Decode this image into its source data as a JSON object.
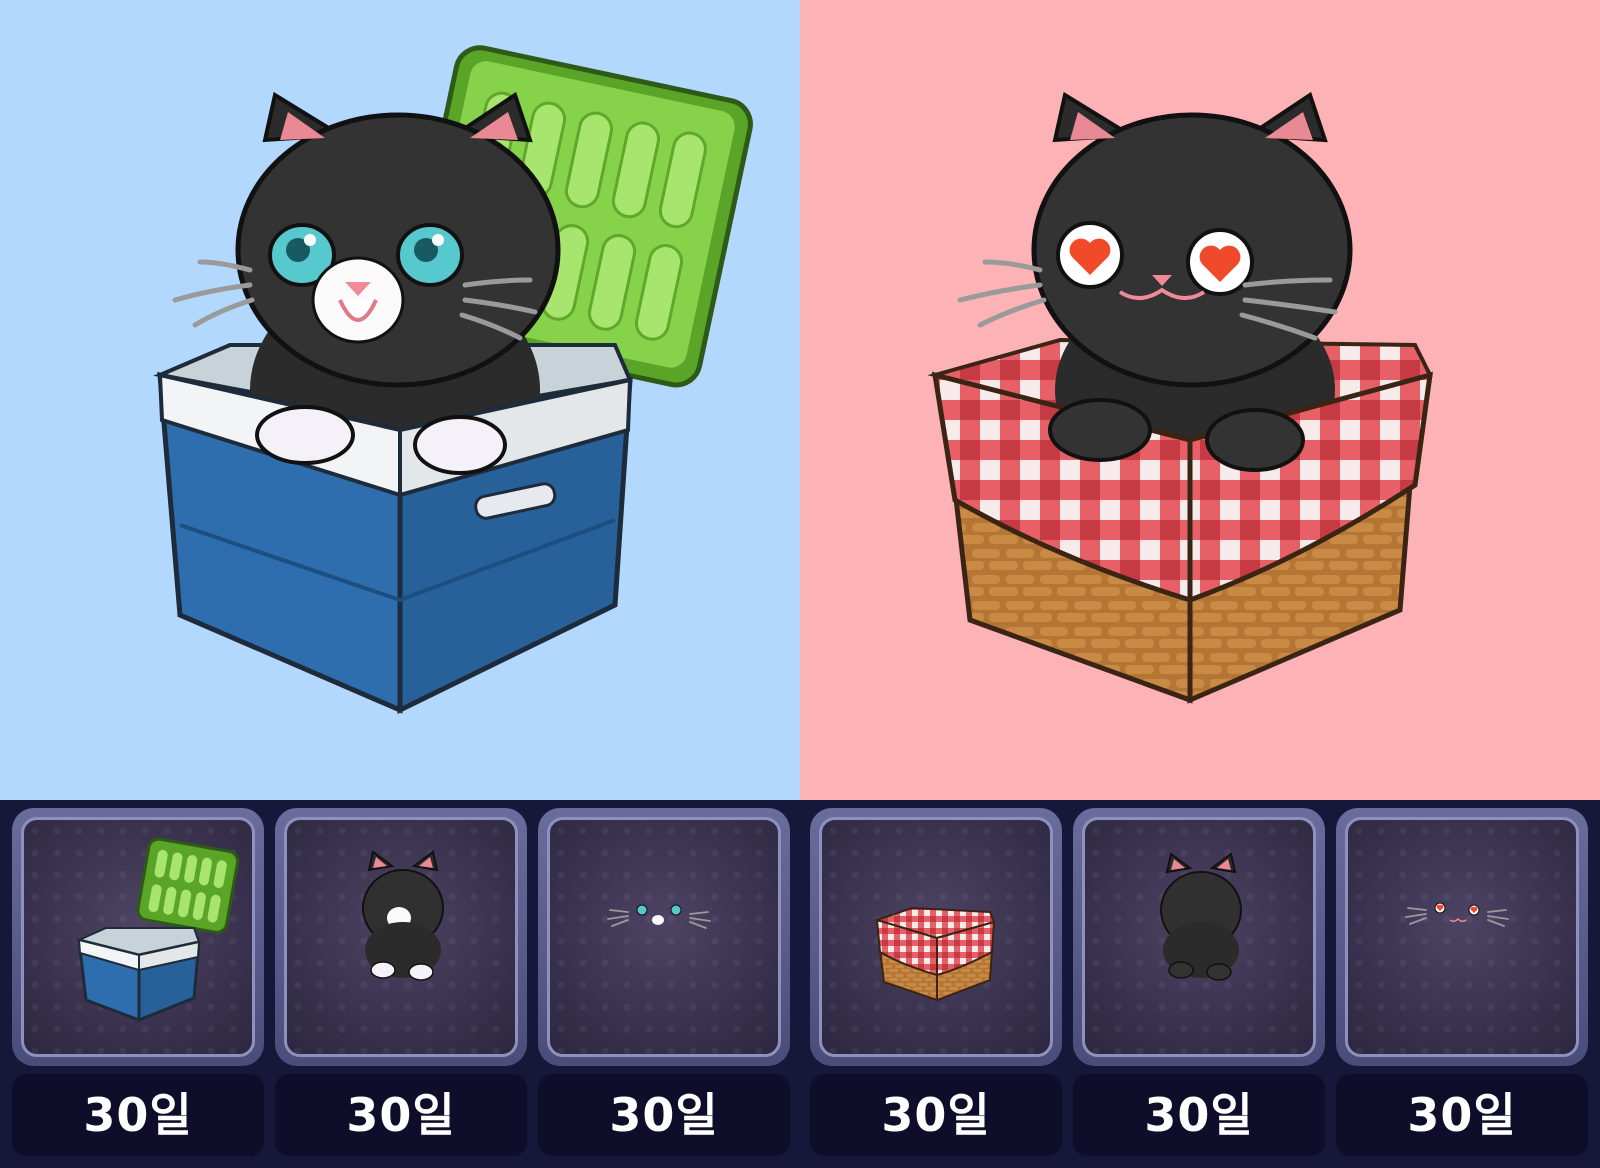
{
  "items": [
    {
      "name": "cooler-box",
      "duration": "30일"
    },
    {
      "name": "tuxedo-cat-body",
      "duration": "30일"
    },
    {
      "name": "cyan-eyes-face",
      "duration": "30일"
    },
    {
      "name": "picnic-basket",
      "duration": "30일"
    },
    {
      "name": "black-cat-body",
      "duration": "30일"
    },
    {
      "name": "heart-eyes-face",
      "duration": "30일"
    }
  ],
  "colors": {
    "left_bg": "#b3d8fe",
    "right_bg": "#fdb3b5",
    "tray_bg": "#17173a",
    "cooler_blue": "#2a6aa8",
    "cooler_lid": "#7acb3a",
    "checker_red": "#e04850",
    "basket_brown": "#b57635"
  }
}
